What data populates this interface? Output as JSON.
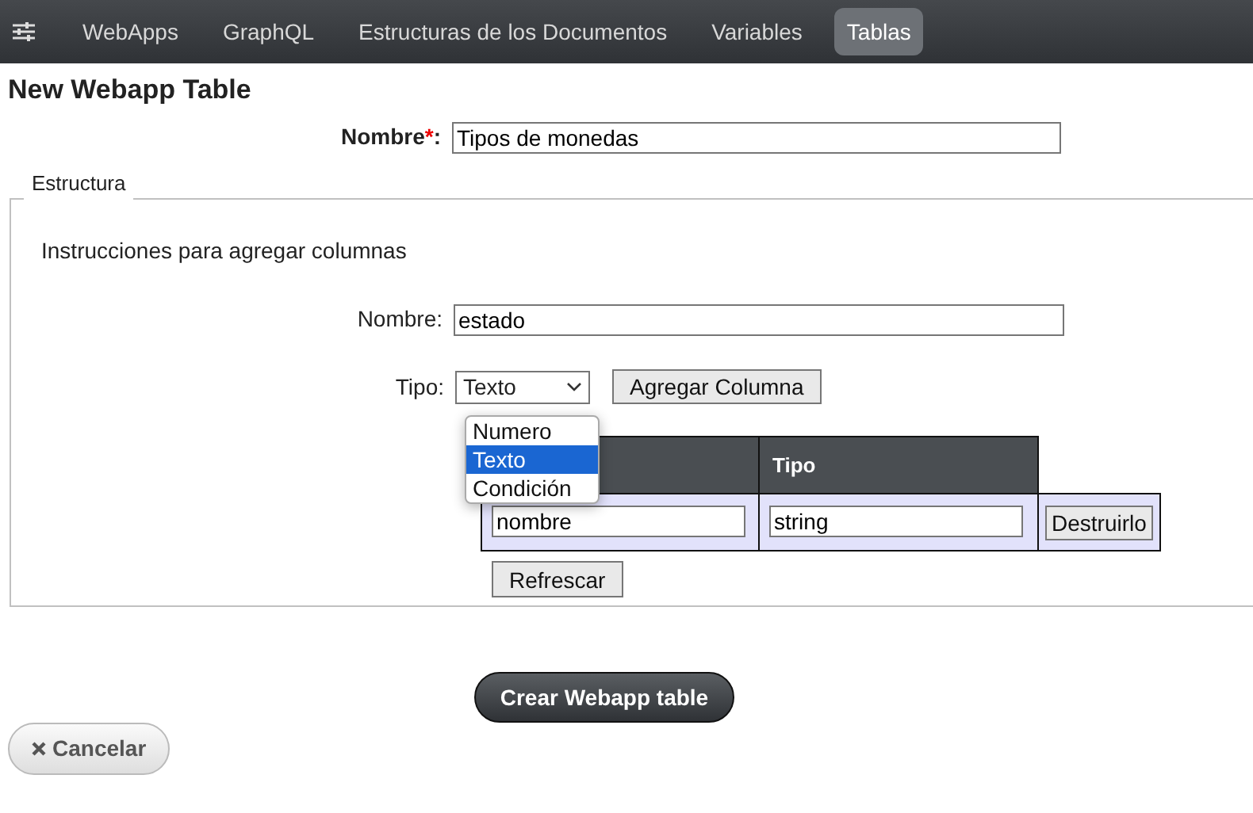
{
  "navbar": {
    "items": [
      {
        "label": "WebApps",
        "selected": false
      },
      {
        "label": "GraphQL",
        "selected": false
      },
      {
        "label": "Estructuras de los Documentos",
        "selected": false
      },
      {
        "label": "Variables",
        "selected": false
      },
      {
        "label": "Tablas",
        "selected": true
      }
    ]
  },
  "title": "New Webapp Table",
  "name_field": {
    "label": "Nombre",
    "required_mark": "*",
    "label_end": ":",
    "value": "Tipos de monedas"
  },
  "structure": {
    "legend": "Estructura",
    "instructions": "Instrucciones para agregar columnas",
    "column_name": {
      "label": "Nombre:",
      "value": "estado"
    },
    "type_select": {
      "label": "Tipo:",
      "value": "Texto",
      "expanded": true,
      "options": [
        {
          "label": "Numero",
          "selected": false
        },
        {
          "label": "Texto",
          "selected": true
        },
        {
          "label": "Condición",
          "selected": false
        }
      ]
    },
    "add_button": "Agregar Columna",
    "table": {
      "columns": [
        "Tipo"
      ],
      "rows": [
        {
          "name": "nombre",
          "type": "string",
          "action": "Destruirlo"
        }
      ]
    },
    "refresh_button": "Refrescar"
  },
  "create_button": "Crear Webapp table",
  "cancel_button": "Cancelar"
}
